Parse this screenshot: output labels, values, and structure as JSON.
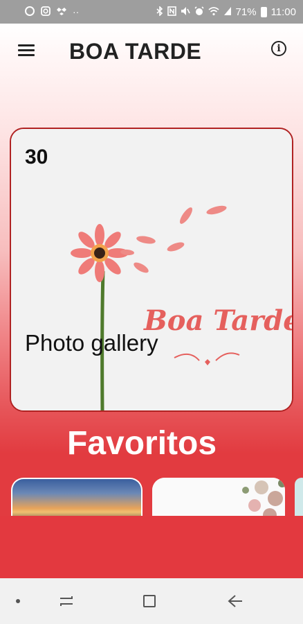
{
  "status_bar": {
    "battery": "71%",
    "time": "11:00",
    "icons_left": [
      "notification-icon",
      "instagram-icon",
      "dropbox-icon",
      "more-dots-icon"
    ],
    "icons_right": [
      "bluetooth-icon",
      "nfc-icon",
      "mute-icon",
      "alarm-icon",
      "wifi-icon",
      "signal-icon",
      "battery-icon"
    ]
  },
  "toolbar": {
    "title": "BOA TARDE",
    "menu_icon": "menu-icon",
    "info_icon": "info-icon"
  },
  "gallery_card": {
    "count": "30",
    "title": "Photo gallery",
    "image_caption": "Boa Tarde"
  },
  "favorites": {
    "title": "Favoritos"
  },
  "colors": {
    "accent_red": "#e3393f",
    "card_border": "#b02222",
    "title_text": "#222222"
  },
  "nav_bar": {
    "items": [
      "home-dot-icon",
      "recents-icon",
      "overview-icon",
      "back-icon"
    ]
  }
}
